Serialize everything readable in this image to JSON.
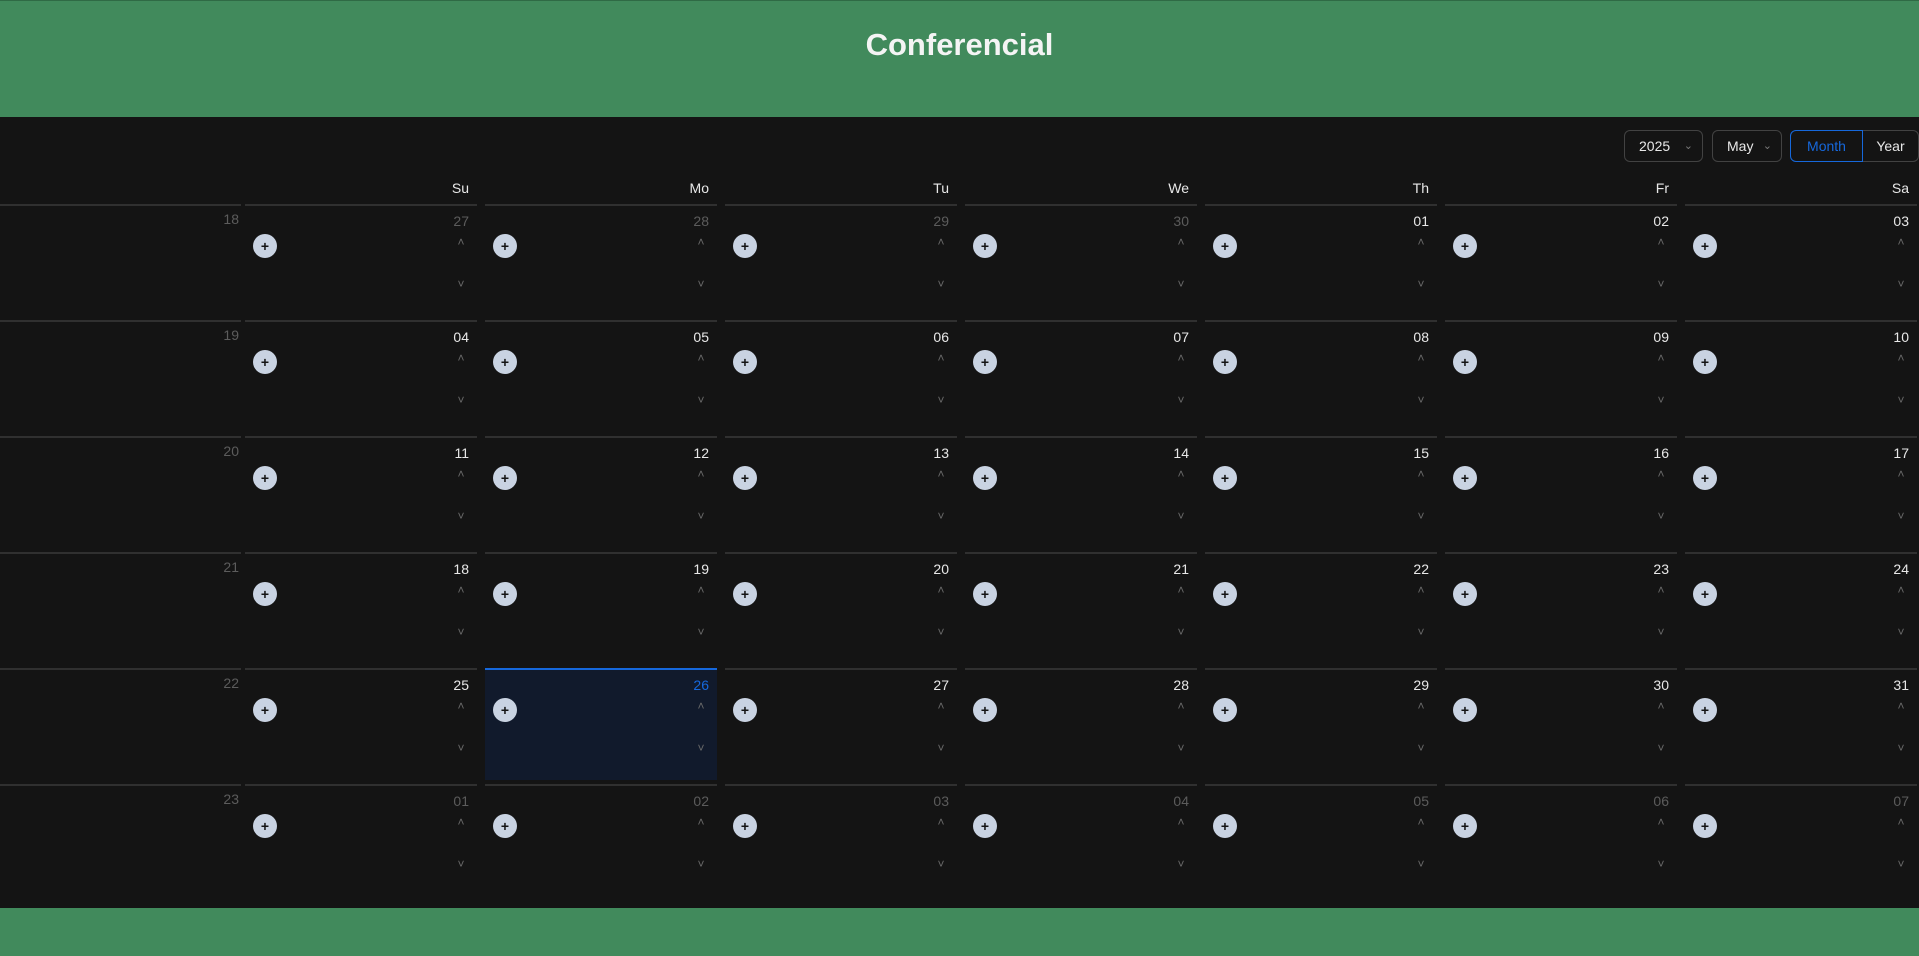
{
  "app_title": "Conferencial",
  "controls": {
    "year": "2025",
    "month": "May",
    "mode_month": "Month",
    "mode_year": "Year"
  },
  "weekdays": [
    "Su",
    "Mo",
    "Tu",
    "We",
    "Th",
    "Fr",
    "Sa"
  ],
  "weeks": [
    {
      "week": "18",
      "days": [
        {
          "d": "27",
          "muted": true
        },
        {
          "d": "28",
          "muted": true
        },
        {
          "d": "29",
          "muted": true
        },
        {
          "d": "30",
          "muted": true
        },
        {
          "d": "01"
        },
        {
          "d": "02"
        },
        {
          "d": "03"
        }
      ]
    },
    {
      "week": "19",
      "days": [
        {
          "d": "04"
        },
        {
          "d": "05"
        },
        {
          "d": "06"
        },
        {
          "d": "07"
        },
        {
          "d": "08"
        },
        {
          "d": "09"
        },
        {
          "d": "10"
        }
      ]
    },
    {
      "week": "20",
      "days": [
        {
          "d": "11"
        },
        {
          "d": "12"
        },
        {
          "d": "13"
        },
        {
          "d": "14"
        },
        {
          "d": "15"
        },
        {
          "d": "16"
        },
        {
          "d": "17"
        }
      ]
    },
    {
      "week": "21",
      "days": [
        {
          "d": "18"
        },
        {
          "d": "19"
        },
        {
          "d": "20"
        },
        {
          "d": "21"
        },
        {
          "d": "22"
        },
        {
          "d": "23"
        },
        {
          "d": "24"
        }
      ]
    },
    {
      "week": "22",
      "days": [
        {
          "d": "25"
        },
        {
          "d": "26",
          "today": true
        },
        {
          "d": "27"
        },
        {
          "d": "28"
        },
        {
          "d": "29"
        },
        {
          "d": "30"
        },
        {
          "d": "31"
        }
      ]
    },
    {
      "week": "23",
      "days": [
        {
          "d": "01",
          "muted": true
        },
        {
          "d": "02",
          "muted": true
        },
        {
          "d": "03",
          "muted": true
        },
        {
          "d": "04",
          "muted": true
        },
        {
          "d": "05",
          "muted": true
        },
        {
          "d": "06",
          "muted": true
        },
        {
          "d": "07",
          "muted": true
        }
      ]
    }
  ],
  "icons": {
    "add": "plus-icon",
    "up": "chevron-up-icon",
    "down": "chevron-down-icon"
  },
  "colors": {
    "header": "#418a5c",
    "background": "#141414",
    "accent": "#1668dc",
    "today_bg": "#111a2c"
  }
}
